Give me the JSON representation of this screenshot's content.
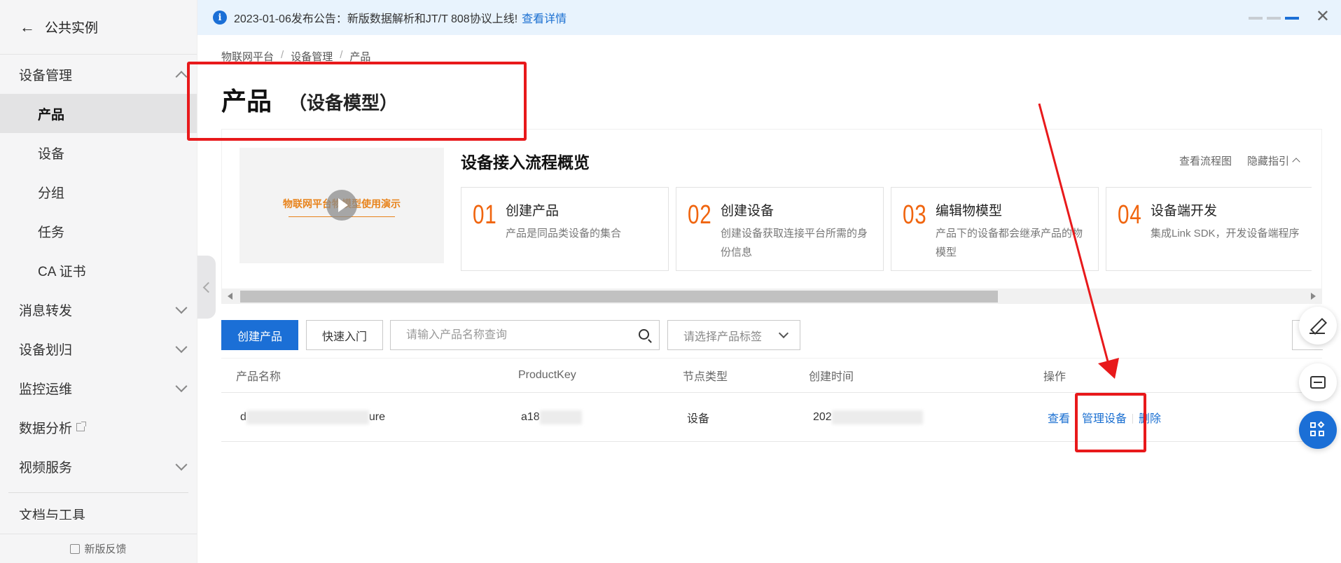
{
  "sidebar": {
    "back_label": "公共实例",
    "items": [
      {
        "label": "设备管理",
        "level": 1
      },
      {
        "label": "产品",
        "level": 2
      },
      {
        "label": "设备",
        "level": 2
      },
      {
        "label": "分组",
        "level": 2
      },
      {
        "label": "任务",
        "level": 2
      },
      {
        "label": "CA 证书",
        "level": 2
      },
      {
        "label": "消息转发",
        "level": 1
      },
      {
        "label": "设备划归",
        "level": 1
      },
      {
        "label": "监控运维",
        "level": 1
      },
      {
        "label": "数据分析",
        "level": 1
      },
      {
        "label": "视频服务",
        "level": 1
      }
    ],
    "cut_label": "文档与工具",
    "feedback_label": "新版反馈"
  },
  "notice": {
    "text": "2023-01-06发布公告：新版数据解析和JT/T 808协议上线!",
    "link": "查看详情"
  },
  "breadcrumb": [
    "物联网平台",
    "设备管理",
    "产品"
  ],
  "page": {
    "title": "产品",
    "subtitle": "（设备模型）"
  },
  "guide": {
    "video_text": "物联网平台物模型使用演示",
    "title": "设备接入流程概览",
    "view_flow": "查看流程图",
    "hide_guide": "隐藏指引",
    "steps": [
      {
        "num": "01",
        "title": "创建产品",
        "desc": "产品是同品类设备的集合"
      },
      {
        "num": "02",
        "title": "创建设备",
        "desc": "创建设备获取连接平台所需的身份信息"
      },
      {
        "num": "03",
        "title": "编辑物模型",
        "desc": "产品下的设备都会继承产品的物模型"
      },
      {
        "num": "04",
        "title": "设备端开发",
        "desc": "集成Link SDK，开发设备端程序"
      }
    ]
  },
  "toolbar": {
    "create_label": "创建产品",
    "quick_label": "快速入门",
    "search_placeholder": "请输入产品名称查询",
    "tag_placeholder": "请选择产品标签"
  },
  "table": {
    "headers": [
      "产品名称",
      "ProductKey",
      "节点类型",
      "创建时间",
      "操作"
    ],
    "rows": [
      {
        "name_start": "d",
        "name_end": "ure",
        "key_start": "a18",
        "node_type": "设备",
        "time_start": "202",
        "actions": [
          "查看",
          "管理设备",
          "删除"
        ]
      }
    ]
  },
  "colors": {
    "primary": "#1b6fd6",
    "step_number": "#f0650f",
    "annotation": "#e8191b",
    "notice_bg": "#e8f3fd"
  },
  "icons": [
    "back-arrow-icon",
    "info-icon",
    "close-icon",
    "play-icon",
    "search-icon",
    "chevron-down-icon",
    "edit-icon",
    "chat-icon",
    "apps-icon",
    "external-link-icon",
    "feedback-icon"
  ]
}
